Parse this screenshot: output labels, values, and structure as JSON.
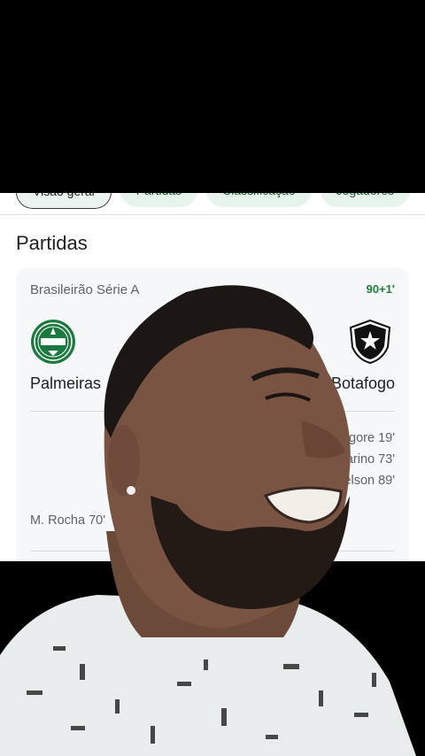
{
  "tabs": [
    {
      "label": "Visão geral"
    },
    {
      "label": "Partidas"
    },
    {
      "label": "Classificação"
    },
    {
      "label": "Jogadores"
    }
  ],
  "section_title": "Partidas",
  "match": {
    "league": "Brasileirão Série A",
    "minute": "90+1'",
    "home_team": "Palmeiras",
    "away_team": "Botafogo",
    "away_scorers": [
      "Igore 19'",
      "Marino 73'",
      "Adryelson 89'"
    ],
    "home_scorers": [
      "M. Rocha 70'"
    ]
  },
  "colors": {
    "live_green": "#188038",
    "chip_bg": "#e6f4ec",
    "palmeiras_green": "#1b7a3e"
  }
}
